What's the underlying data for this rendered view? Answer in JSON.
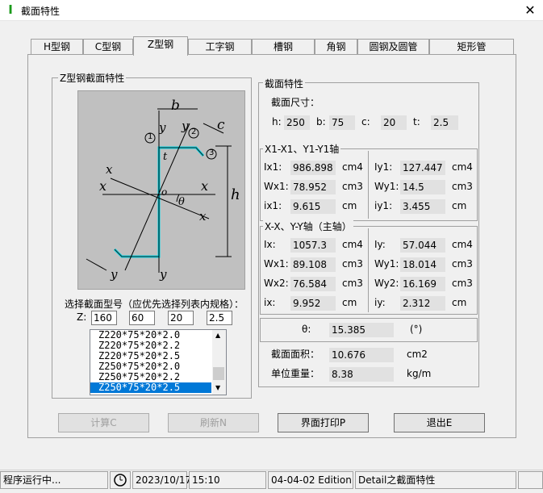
{
  "window": {
    "title": "截面特性",
    "close_glyph": "✕"
  },
  "tabs": [
    "H型钢",
    "C型钢",
    "Z型钢",
    "工字钢",
    "槽钢",
    "角钢",
    "圆钢及圆管",
    "矩形管"
  ],
  "active_tab": "Z型钢",
  "left_group": {
    "title": "Z型钢截面特性",
    "drawing_labels": {
      "b": "b",
      "c": "c",
      "t": "t",
      "h": "h",
      "x": "x",
      "x1": "x",
      "y": "y",
      "y1": "y",
      "sub1": "1",
      "o": "o",
      "theta": "θ",
      "n1": "1",
      "n2": "2",
      "n3": "3"
    },
    "select_label": "选择截面型号（应优先选择列表内规格）：",
    "z_label": "Z:",
    "z_values": [
      "160",
      "60",
      "20",
      "2.5"
    ],
    "list_items": [
      "Z220*75*20*2.0",
      "Z220*75*20*2.2",
      "Z220*75*20*2.5",
      "Z250*75*20*2.0",
      "Z250*75*20*2.2",
      "Z250*75*20*2.5"
    ],
    "selected_item": "Z250*75*20*2.5"
  },
  "right_group": {
    "title": "截面特性",
    "size_label": "截面尺寸：",
    "dims": [
      {
        "label": "h:",
        "value": "250"
      },
      {
        "label": "b:",
        "value": "75"
      },
      {
        "label": "c:",
        "value": "20"
      },
      {
        "label": "t:",
        "value": "2.5"
      }
    ],
    "axis1_title": "X1-X1、Y1-Y1轴",
    "axis1_left": [
      {
        "label": "Ix1:",
        "value": "986.898",
        "unit": "cm4"
      },
      {
        "label": "Wx1:",
        "value": "78.952",
        "unit": "cm3"
      },
      {
        "label": "ix1:",
        "value": "9.615",
        "unit": "cm"
      }
    ],
    "axis1_right": [
      {
        "label": "Iy1:",
        "value": "127.447",
        "unit": "cm4"
      },
      {
        "label": "Wy1:",
        "value": "14.5",
        "unit": "cm3"
      },
      {
        "label": "iy1:",
        "value": "3.455",
        "unit": "cm"
      }
    ],
    "axis2_title": "X-X、Y-Y轴（主轴）",
    "axis2_left": [
      {
        "label": "Ix:",
        "value": "1057.3",
        "unit": "cm4"
      },
      {
        "label": "Wx1:",
        "value": "89.108",
        "unit": "cm3"
      },
      {
        "label": "Wx2:",
        "value": "76.584",
        "unit": "cm3"
      },
      {
        "label": "ix:",
        "value": "9.952",
        "unit": "cm"
      }
    ],
    "axis2_right": [
      {
        "label": "Iy:",
        "value": "57.044",
        "unit": "cm4"
      },
      {
        "label": "Wy1:",
        "value": "18.014",
        "unit": "cm3"
      },
      {
        "label": "Wy2:",
        "value": "16.169",
        "unit": "cm3"
      },
      {
        "label": "iy:",
        "value": "2.312",
        "unit": "cm"
      }
    ],
    "theta": {
      "label": "θ:",
      "value": "15.385",
      "unit": "(°)"
    },
    "area": {
      "label": "截面面积：",
      "value": "10.676",
      "unit": "cm2"
    },
    "weight": {
      "label": "单位重量：",
      "value": "8.38",
      "unit": "kg/m"
    }
  },
  "buttons": {
    "calc": "计算C",
    "refresh": "刷新N",
    "print": "界面打印P",
    "exit": "退出E"
  },
  "statusbar": {
    "running": "程序运行中...",
    "date": "2023/10/17",
    "time": "15:10",
    "edition": "04-04-02 Edition",
    "module": "Detail之截面特性"
  }
}
